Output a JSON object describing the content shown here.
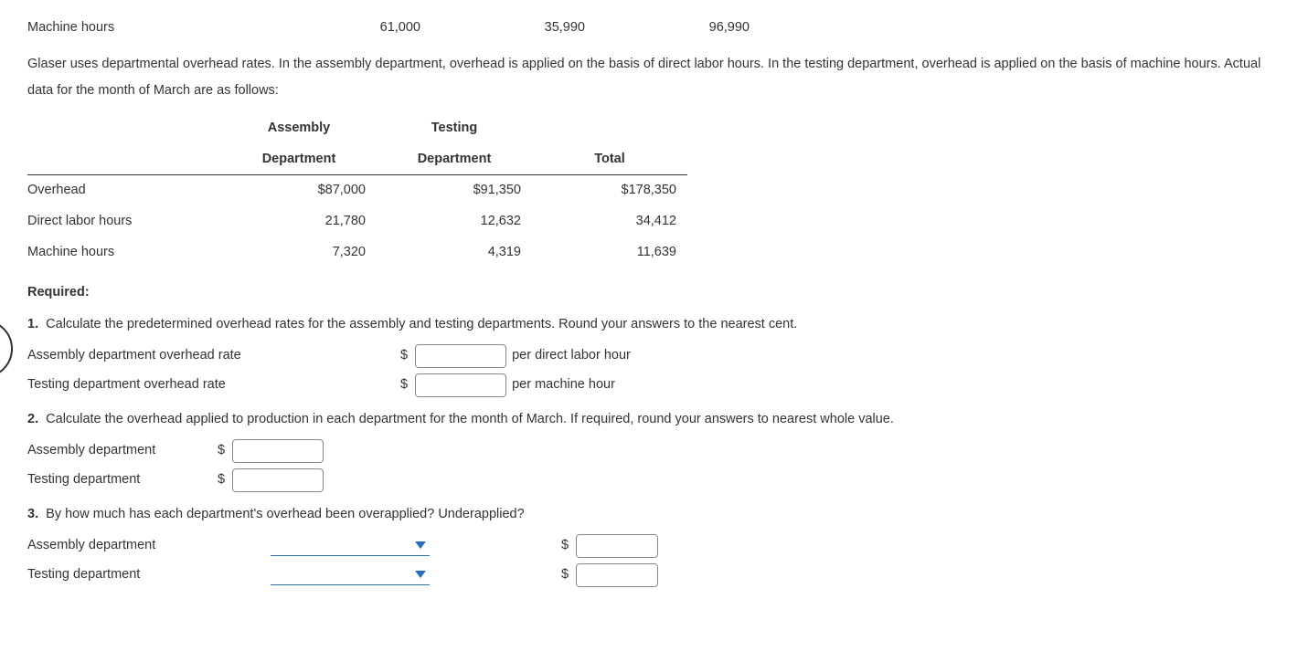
{
  "top_row": {
    "label": "Machine hours",
    "c1": "61,000",
    "c2": "35,990",
    "c3": "96,990"
  },
  "intro": "Glaser uses departmental overhead rates. In the assembly department, overhead is applied on the basis of direct labor hours. In the testing department, overhead is applied on the basis of machine hours. Actual data for the month of March are as follows:",
  "table": {
    "h1a": "Assembly",
    "h1b": "Department",
    "h2a": "Testing",
    "h2b": "Department",
    "h3": "Total",
    "rows": [
      {
        "label": "Overhead",
        "c1": "$87,000",
        "c2": "$91,350",
        "c3": "$178,350"
      },
      {
        "label": "Direct labor hours",
        "c1": "21,780",
        "c2": "12,632",
        "c3": "34,412"
      },
      {
        "label": "Machine hours",
        "c1": "7,320",
        "c2": "4,319",
        "c3": "11,639"
      }
    ]
  },
  "required": "Required:",
  "q1": {
    "num": "1.",
    "text": "Calculate the predetermined overhead rates for the assembly and testing departments. Round your answers to the nearest cent.",
    "row1_label": "Assembly department overhead rate",
    "row1_unit": "per direct labor hour",
    "row2_label": "Testing department overhead rate",
    "row2_unit": "per machine hour"
  },
  "q2": {
    "num": "2.",
    "text": "Calculate the overhead applied to production in each department for the month of March. If required, round your answers to nearest whole value.",
    "row1_label": "Assembly department",
    "row2_label": "Testing department"
  },
  "q3": {
    "num": "3.",
    "text": "By how much has each department's overhead been overapplied? Underapplied?",
    "row1_label": "Assembly department",
    "row2_label": "Testing department"
  },
  "dollar": "$"
}
